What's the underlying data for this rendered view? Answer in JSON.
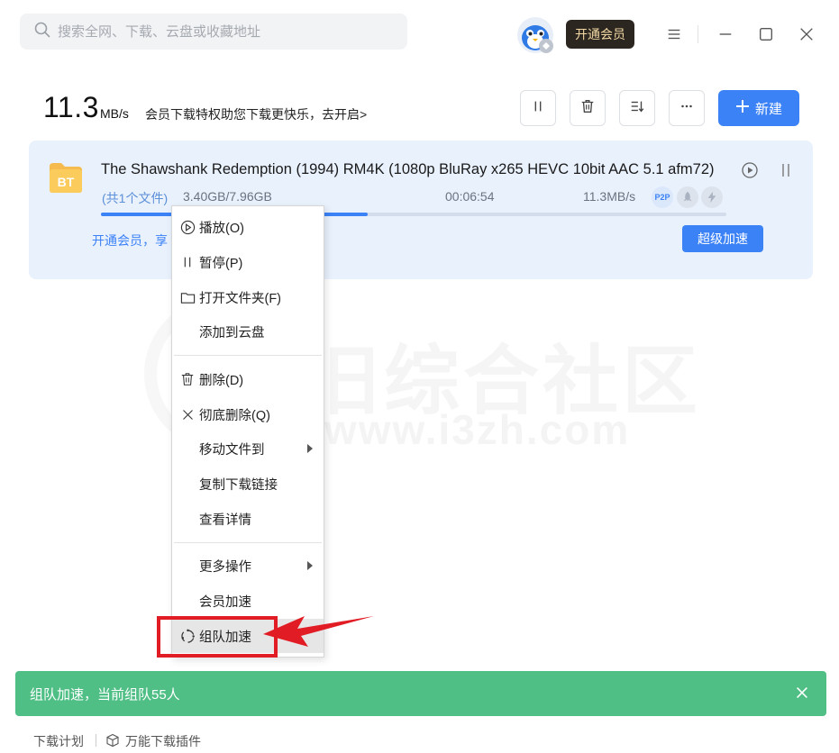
{
  "search": {
    "placeholder": "搜索全网、下载、云盘或收藏地址"
  },
  "header": {
    "vip_button": "开通会员",
    "icons": [
      "menu-icon",
      "minimize-icon",
      "maximize-icon",
      "close-icon"
    ]
  },
  "speed": {
    "value": "11.3",
    "unit": "MB/s",
    "promo": "会员下载特权助您下载更快乐，去开启>"
  },
  "toolbar": {
    "icons": [
      "pause-all-icon",
      "delete-icon",
      "sort-icon",
      "more-icon"
    ],
    "new_button": "新建"
  },
  "download": {
    "badge": "BT",
    "title": "The Shawshank Redemption (1994) RM4K (1080p BluRay x265 HEVC 10bit AAC 5.1 afm72)",
    "file_count": "(共1个文件)",
    "size": "3.40GB/7.96GB",
    "time_left": "00:06:54",
    "speed": "11.3MB/s",
    "p2p": "P2P",
    "progress": 0.427,
    "vip_promo": "开通会员，享",
    "super_button": "超级加速"
  },
  "watermark": {
    "text": "旧综合社区",
    "url": "www.i3zh.com"
  },
  "context_menu": {
    "items": [
      {
        "label": "播放(O)",
        "icon": "play-circle-icon"
      },
      {
        "label": "暂停(P)",
        "icon": "pause-icon"
      },
      {
        "label": "打开文件夹(F)",
        "icon": "folder-icon"
      },
      {
        "label": "添加到云盘",
        "icon": ""
      },
      {
        "label": "删除(D)",
        "icon": "trash-icon"
      },
      {
        "label": "彻底删除(Q)",
        "icon": "x-icon"
      },
      {
        "label": "移动文件到",
        "icon": "",
        "submenu": true
      },
      {
        "label": "复制下载链接",
        "icon": ""
      },
      {
        "label": "查看详情",
        "icon": ""
      },
      {
        "label": "更多操作",
        "icon": "",
        "submenu": true
      },
      {
        "label": "会员加速",
        "icon": ""
      },
      {
        "label": "组队加速",
        "icon": "team-circle-icon"
      }
    ]
  },
  "toast": {
    "message": "组队加速，当前组队55人"
  },
  "footer": {
    "plan": "下载计划",
    "plugin": "万能下载插件"
  },
  "colors": {
    "accent": "#3b82f6",
    "toast": "#4fbf85",
    "highlight": "#e21c24"
  }
}
